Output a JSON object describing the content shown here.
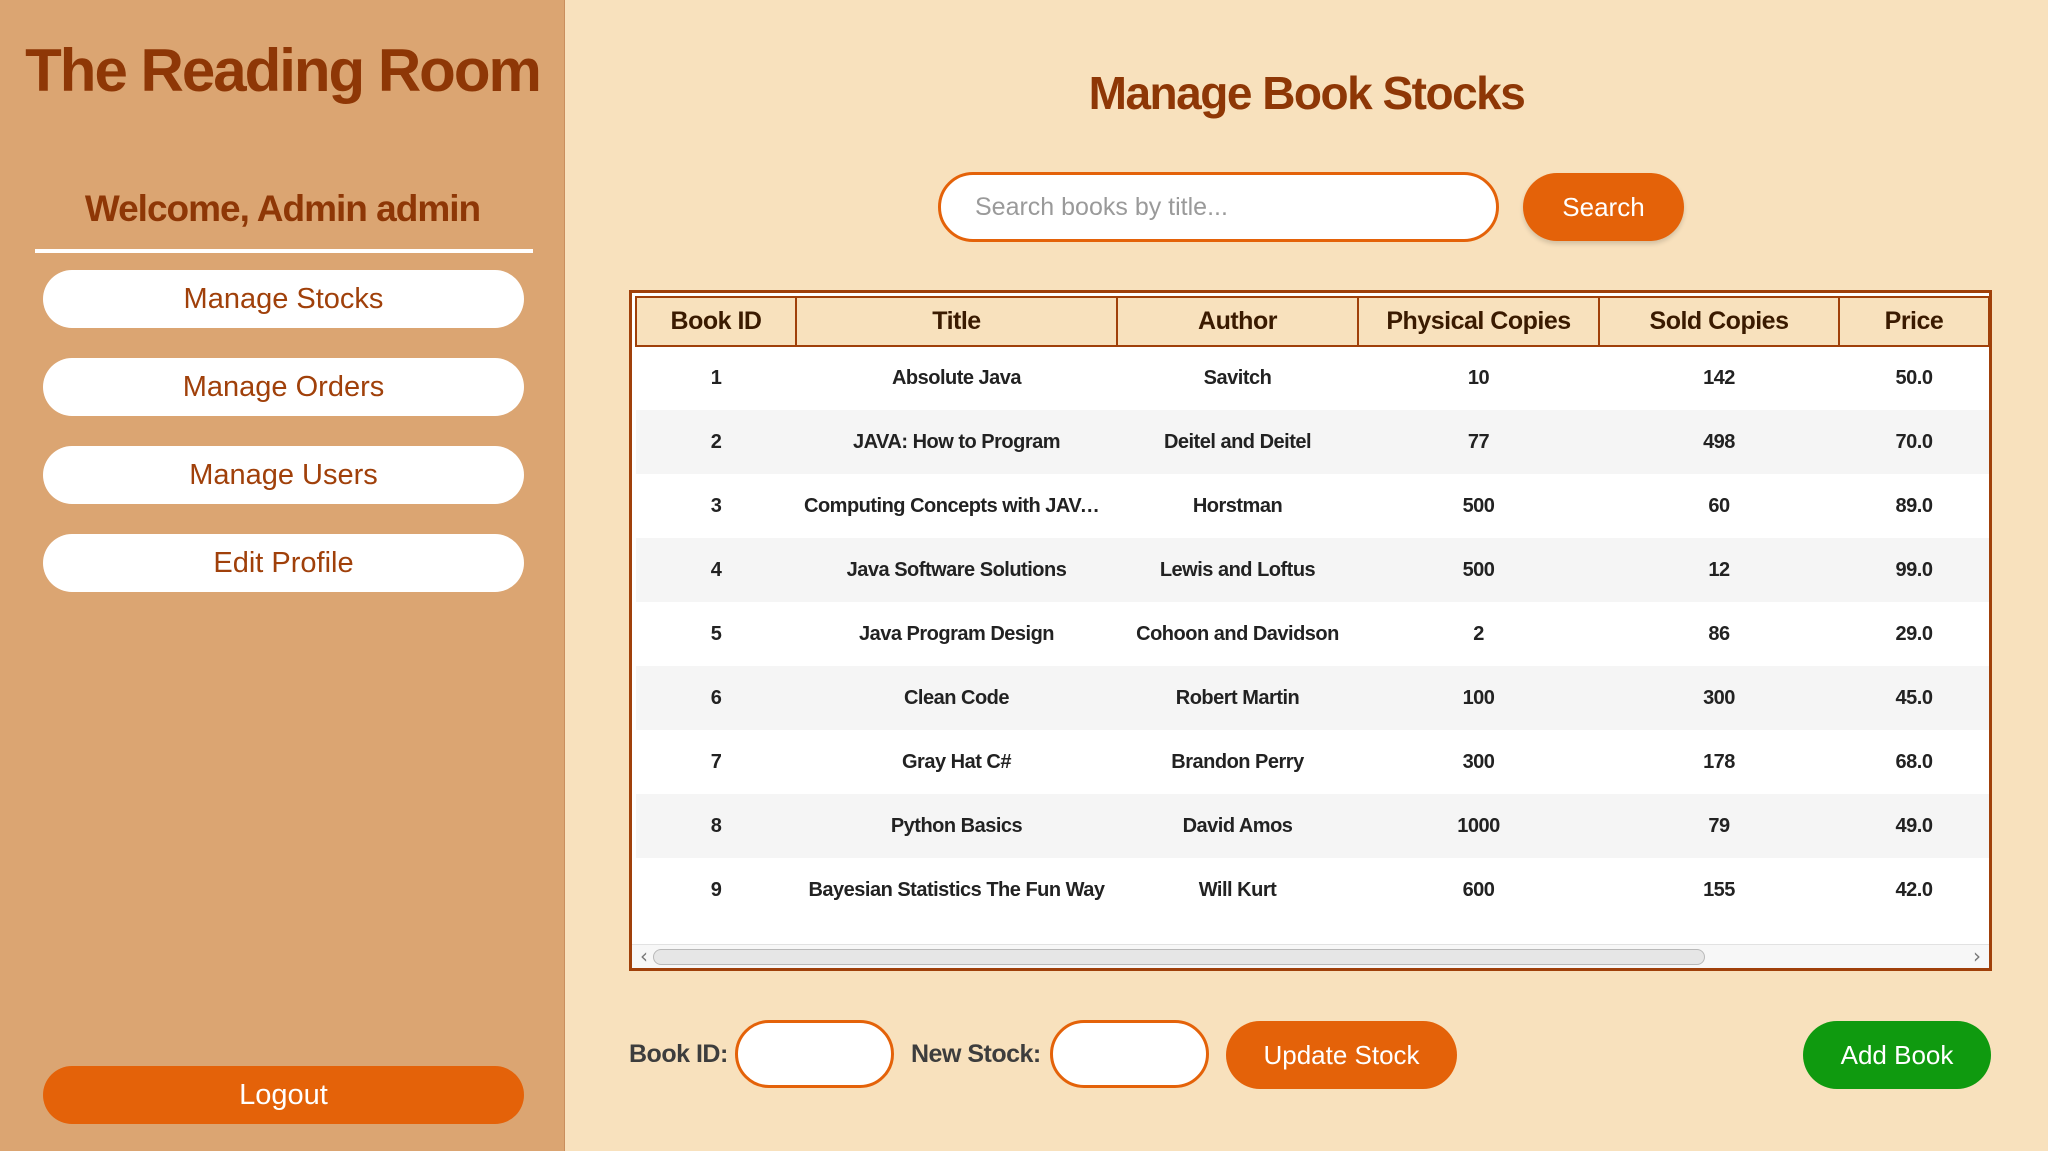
{
  "sidebar": {
    "app_title": "The Reading Room",
    "welcome": "Welcome, Admin admin",
    "nav": {
      "manage_stocks": "Manage Stocks",
      "manage_orders": "Manage Orders",
      "manage_users": "Manage Users",
      "edit_profile": "Edit Profile"
    },
    "logout": "Logout"
  },
  "main": {
    "title": "Manage Book Stocks",
    "search": {
      "placeholder": "Search books by title...",
      "value": "",
      "button": "Search"
    },
    "table": {
      "headers": [
        "Book ID",
        "Title",
        "Author",
        "Physical Copies",
        "Sold Copies",
        "Price"
      ],
      "rows": [
        [
          "1",
          "Absolute Java",
          "Savitch",
          "10",
          "142",
          "50.0"
        ],
        [
          "2",
          "JAVA: How to Program",
          "Deitel and Deitel",
          "77",
          "498",
          "70.0"
        ],
        [
          "3",
          "Computing Concepts with JAVA ...",
          "Horstman",
          "500",
          "60",
          "89.0"
        ],
        [
          "4",
          "Java Software Solutions",
          "Lewis and Loftus",
          "500",
          "12",
          "99.0"
        ],
        [
          "5",
          "Java Program Design",
          "Cohoon and Davidson",
          "2",
          "86",
          "29.0"
        ],
        [
          "6",
          "Clean Code",
          "Robert Martin",
          "100",
          "300",
          "45.0"
        ],
        [
          "7",
          "Gray Hat C#",
          "Brandon Perry",
          "300",
          "178",
          "68.0"
        ],
        [
          "8",
          "Python Basics",
          "David Amos",
          "1000",
          "79",
          "49.0"
        ],
        [
          "9",
          "Bayesian Statistics The Fun Way",
          "Will Kurt",
          "600",
          "155",
          "42.0"
        ]
      ]
    },
    "bottom": {
      "book_id_label": "Book ID:",
      "book_id_value": "",
      "new_stock_label": "New Stock:",
      "new_stock_value": "",
      "update_button": "Update Stock",
      "add_button": "Add Book"
    }
  },
  "colors": {
    "background": "#f8e1bd",
    "sidebar": "#dba572",
    "accent": "#e46209",
    "title_text": "#8e3706",
    "add_button": "#0f9a0f"
  },
  "icons": {
    "scroll_left": "chevron-left-icon",
    "scroll_right": "chevron-right-icon"
  }
}
